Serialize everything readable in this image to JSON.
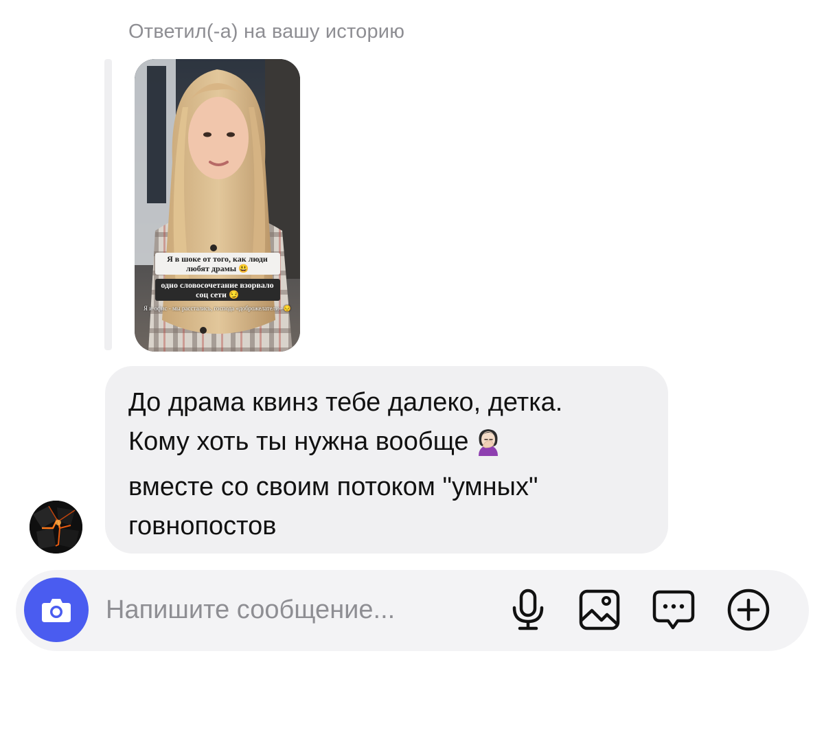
{
  "story_reply": {
    "caption": "Ответил(-а) на вашу историю",
    "story_texts": {
      "line1": "Я в шоке от того, как люди любят драмы 😃",
      "line2": "одно словосочетание взорвало соц сети 😏",
      "line3": "Я и офис - мы расстались, господа «доброжелатели» 😔"
    }
  },
  "message": {
    "text": "До драма квинз тебе далеко, детка.\nКому хоть ты нужна вообще",
    "text_tail": "вместе со своим потоком \"умных\"\nговнопостов",
    "emoji": "woman-facepalming-icon"
  },
  "composer": {
    "placeholder": "Напишите сообщение...",
    "camera_icon": "camera-icon",
    "tools": [
      "microphone-icon",
      "gallery-icon",
      "sticker-chat-icon",
      "plus-icon"
    ]
  },
  "colors": {
    "accent": "#4a5cf0",
    "bubble": "#f0f0f2",
    "composer_bg": "#f3f3f5",
    "secondary_text": "#8e8e93"
  }
}
